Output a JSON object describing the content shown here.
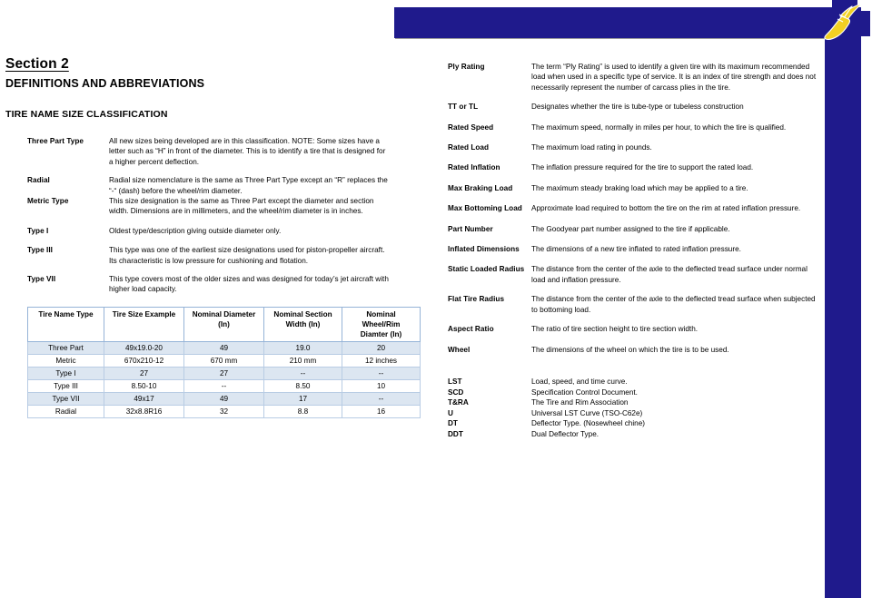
{
  "brand": {
    "banner_color": "#1f1a8c",
    "logo_accent_color": "#f2d024",
    "logo_name": "goodyear-winged-foot-logo"
  },
  "document": {
    "section_heading": "Section 2",
    "subtitle": "DEFINITIONS AND ABBREVIATIONS",
    "classification_heading": "TIRE NAME SIZE CLASSIFICATION"
  },
  "left_definitions": [
    {
      "term": "Three Part Type",
      "description": "All new sizes being developed are in this classification.  NOTE:  Some sizes have a letter such as “H” in front of the diameter.  This is to identify a tire that is designed for a higher percent deflection.",
      "gap_after": 9
    },
    {
      "term": "Radial",
      "description": "Radial size nomenclature is the same as Three Part Type except an “R” replaces the “-“ (dash) before the wheel/rim diameter.",
      "gap_after": 0
    },
    {
      "term": "Metric Type",
      "description": "This size designation is the same as Three Part except the diameter and section width. Dimensions are in millimeters, and the wheel/rim diameter is in inches.",
      "gap_after": 10
    },
    {
      "term": "Type I",
      "description": "Oldest type/description giving outside diameter only.",
      "gap_after": 10
    },
    {
      "term": "Type III",
      "description": "This type was one of the earliest size designations used for piston-propeller aircraft. Its characteristic is low pressure for cushioning and flotation.",
      "gap_after": 9
    },
    {
      "term": "Type VII",
      "description": "This type covers most of the older sizes and was designed for today’s jet aircraft with higher load capacity.",
      "gap_after": 0
    }
  ],
  "size_table": {
    "headers": [
      "Tire Name Type",
      "Tire Size Example",
      "Nominal Diameter (In)",
      "Nominal Section Width (In)",
      "Nominal Wheel/Rim Diamter (In)"
    ],
    "header_lines": [
      [
        "Tire Name Type"
      ],
      [
        "Tire Size Example"
      ],
      [
        "Nominal Diameter",
        "(In)"
      ],
      [
        "Nominal Section",
        "Width (In)"
      ],
      [
        "Nominal",
        "Wheel/Rim",
        "Diamter (In)"
      ]
    ],
    "rows": [
      [
        "Three Part",
        "49x19.0-20",
        "49",
        "19.0",
        "20"
      ],
      [
        "Metric",
        "670x210-12",
        "670 mm",
        "210 mm",
        "12 inches"
      ],
      [
        "Type I",
        "27",
        "27",
        "--",
        "--"
      ],
      [
        "Type III",
        "8.50-10",
        "--",
        "8.50",
        "10"
      ],
      [
        "Type VII",
        "49x17",
        "49",
        "17",
        "--"
      ],
      [
        "Radial",
        "32x8.8R16",
        "32",
        "8.8",
        "16"
      ]
    ],
    "stripe_color": "#dce6f1",
    "border_color": "#b8cce4"
  },
  "right_definitions": [
    {
      "term": "Ply Rating",
      "description": "The term “Ply Rating” is used to identify a given tire with its maximum recommended\nload when used in a specific type of service.  It is an index of tire strength and does not necessarily represent the number of carcass plies in the tire.",
      "gap_after": 10
    },
    {
      "term": "TT or TL",
      "description": "Designates whether the tire is tube-type or tubeless construction",
      "gap_after": 11
    },
    {
      "term": "Rated Speed",
      "description": "The maximum speed, normally in miles per hour, to which the tire is qualified.",
      "gap_after": 11
    },
    {
      "term": "Rated Load",
      "description": "The maximum load rating in pounds.",
      "gap_after": 11
    },
    {
      "term": "Rated Inflation",
      "description": "The inflation pressure required for the tire to support the rated load.",
      "gap_after": 11
    },
    {
      "term": "Max Braking Load",
      "description": "The maximum steady braking load which may be applied to a tire.",
      "gap_after": 11
    },
    {
      "term": "Max Bottoming Load",
      "description": "Approximate load required to bottom the tire on the rim at rated inflation pressure.",
      "gap_after": 11
    },
    {
      "term": "Part Number",
      "description": "The Goodyear part number assigned to the tire if applicable.",
      "gap_after": 11
    },
    {
      "term": "Inflated Dimensions",
      "description": "The dimensions of a new tire inflated to rated inflation pressure.",
      "gap_after": 11
    },
    {
      "term": "Static Loaded Radius",
      "description": "The distance from the center of the axle to the deflected tread surface under normal load and inflation pressure.",
      "gap_after": 10
    },
    {
      "term": "Flat Tire Radius",
      "description": "The distance from the center of the axle to the deflected tread surface when subjected to bottoming load.",
      "gap_after": 10
    },
    {
      "term": "Aspect Ratio",
      "description": "The ratio of tire section height to tire section width.",
      "gap_after": 11
    },
    {
      "term": "Wheel",
      "description": "The dimensions of the wheel on which the tire is to be used.",
      "gap_after": 0
    }
  ],
  "abbreviations": [
    {
      "term": "LST",
      "description": "Load, speed, and time curve."
    },
    {
      "term": "SCD",
      "description": "Specification Control Document."
    },
    {
      "term": "T&RA",
      "description": "The Tire and Rim Association"
    },
    {
      "term": "U",
      "description": "Universal LST Curve (TSO-C62e)"
    },
    {
      "term": "DT",
      "description": "Deflector Type.  (Nosewheel chine)"
    },
    {
      "term": "DDT",
      "description": "Dual Deflector Type."
    }
  ]
}
